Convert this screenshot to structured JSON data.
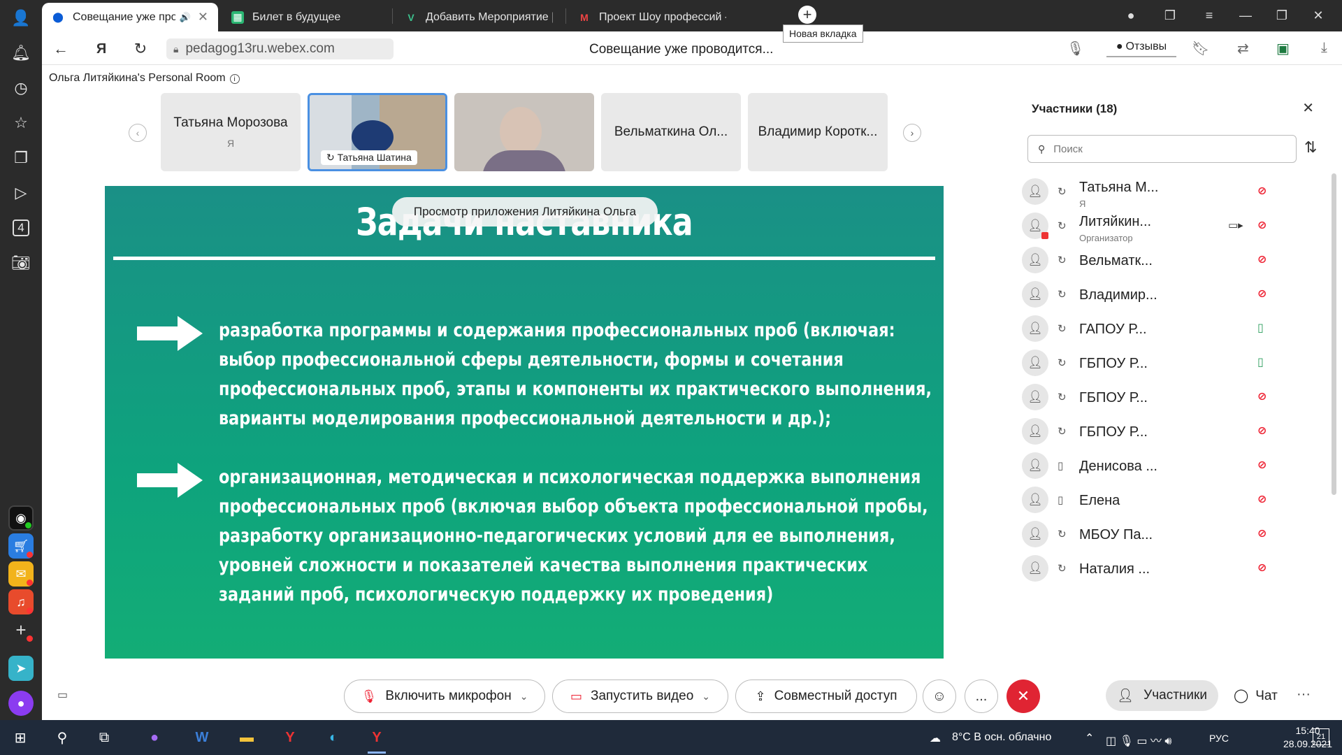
{
  "browser": {
    "tabs": [
      {
        "title": "Совещание уже про",
        "audio": "🔊"
      },
      {
        "title": "Билет в будущее"
      },
      {
        "title": "Добавить Мероприятие |"
      },
      {
        "title": "Проект Шоу профессий -"
      }
    ],
    "new_tab_tooltip": "Новая вкладка",
    "url": "pedagog13ru.webex.com",
    "page_title": "Совещание уже проводится...",
    "reviews_label": "Отзывы"
  },
  "rail": {
    "tab_badge": "4"
  },
  "meeting": {
    "room_name": "Ольга Литяйкина's Personal Room",
    "thumbnails": [
      {
        "name": "Татьяна Морозова",
        "sub": "Я"
      },
      {
        "name": "Татьяна Шатина"
      },
      {
        "name": ""
      },
      {
        "name": "Вельматкина Ол..."
      },
      {
        "name": "Владимир Коротк..."
      }
    ],
    "app_view_label": "Просмотр приложения  Литяйкина Ольга"
  },
  "slide": {
    "title": "Задачи наставника",
    "bullets": [
      "разработка программы и содержания профессиональных проб (включая: выбор профессиональной сферы деятельности, формы и сочетания профессиональных проб, этапы и компоненты их практического выполнения, варианты моделирования профессиональной деятельности и др.);",
      "организационная, методическая и психологическая поддержка выполнения профессиональных проб (включая выбор объекта профессиональной пробы, разработку организационно-педагогических условий для ее выполнения, уровней сложности и показателей качества выполнения практических заданий проб, психологическую поддержку их проведения)"
    ],
    "colors": {
      "bg_top": "#1a9086",
      "bg_bottom": "#13ad76",
      "text": "#ffffff"
    }
  },
  "participants": {
    "header": "Участники (18)",
    "search_placeholder": "Поиск",
    "list": [
      {
        "name": "Татьяна М...",
        "sub": "Я",
        "mic": "muted"
      },
      {
        "name": "Литяйкин...",
        "sub": "Организатор",
        "mic": "muted",
        "video": true,
        "host": true
      },
      {
        "name": "Вельматк...",
        "mic": "muted"
      },
      {
        "name": "Владимир...",
        "mic": "muted"
      },
      {
        "name": "ГАПОУ Р...",
        "mic": "on"
      },
      {
        "name": "ГБПОУ Р...",
        "mic": "on"
      },
      {
        "name": "ГБПОУ Р...",
        "mic": "muted"
      },
      {
        "name": "ГБПОУ Р...",
        "mic": "muted"
      },
      {
        "name": "Денисова ...",
        "mic": "muted",
        "device": "phone"
      },
      {
        "name": "Елена",
        "mic": "muted",
        "device": "phone"
      },
      {
        "name": "МБОУ Па...",
        "mic": "muted"
      },
      {
        "name": "Наталия ...",
        "mic": "muted"
      }
    ]
  },
  "controls": {
    "mic_label": "Включить микрофон",
    "video_label": "Запустить видео",
    "share_label": "Совместный доступ",
    "participants_label": "Участники",
    "chat_label": "Чат",
    "more_label": "...",
    "more_side_label": "···"
  },
  "taskbar": {
    "weather": "8°C  В осн. облачно",
    "lang": "РУС",
    "time": "15:40",
    "date": "28.09.2021",
    "notifications": "21"
  },
  "icons": [
    "user-icon",
    "bell-icon",
    "history-icon",
    "star-icon",
    "collections-icon",
    "play-icon",
    "camera-icon",
    "back-icon",
    "yandex-icon",
    "reload-icon",
    "lock-icon",
    "mic-icon",
    "bookmark-icon",
    "download-icon",
    "search-icon",
    "sort-icon",
    "close-icon",
    "emoji-icon",
    "share-icon",
    "chat-icon",
    "windows-icon"
  ]
}
